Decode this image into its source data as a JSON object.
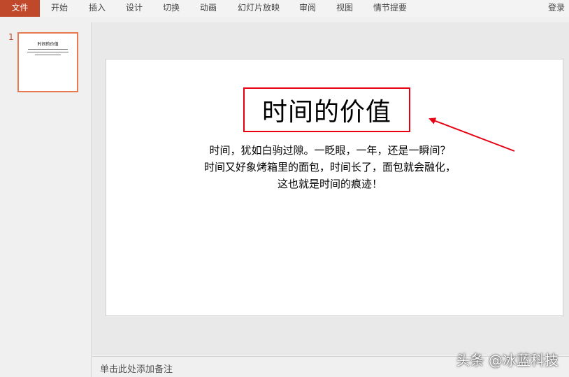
{
  "ribbon": {
    "file_tab": "文件",
    "tabs": [
      "开始",
      "插入",
      "设计",
      "切换",
      "动画",
      "幻灯片放映",
      "审阅",
      "视图",
      "情节提要"
    ],
    "login": "登录"
  },
  "thumbnails": {
    "slide_number": "1"
  },
  "slide": {
    "title": "时间的价值",
    "body_lines": [
      "时间，犹如白驹过隙。一眨眼，一年，还是一瞬间？",
      "时间又好象烤箱里的面包，时间长了，面包就会融化，",
      "这也就是时间的痕迹！"
    ],
    "highlight_color": "#e60012"
  },
  "notes": {
    "placeholder": "单击此处添加备注"
  },
  "watermark": "头条 @冰蓝科技",
  "colors": {
    "file_tab": "#c0482b",
    "thumbnail_border": "#e77950"
  }
}
